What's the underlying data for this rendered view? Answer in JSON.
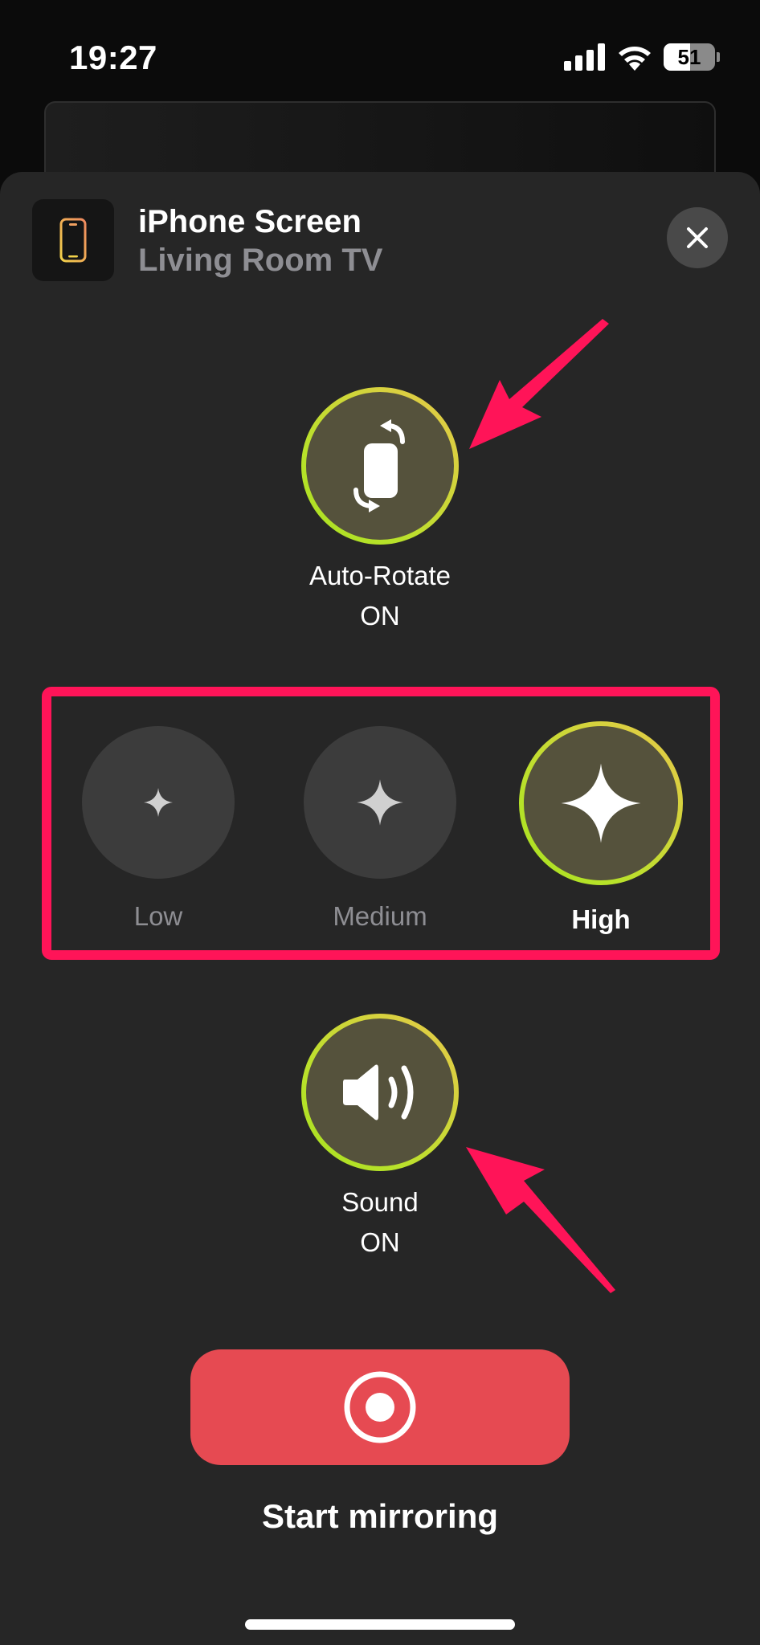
{
  "status_bar": {
    "time": "19:27",
    "battery_percent": 51,
    "battery_label": "51",
    "icons": [
      "cellular-signal-icon",
      "wifi-icon",
      "battery-icon"
    ]
  },
  "header": {
    "title": "iPhone Screen",
    "subtitle": "Living Room TV",
    "app_icon": "iphone-icon",
    "close_icon": "close-icon"
  },
  "auto_rotate": {
    "icon": "rotate-device-icon",
    "label": "Auto-Rotate",
    "state": "ON"
  },
  "quality": {
    "selected": "High",
    "options": [
      {
        "label": "Low",
        "icon": "sparkle-small-icon",
        "selected": false
      },
      {
        "label": "Medium",
        "icon": "sparkle-medium-icon",
        "selected": false
      },
      {
        "label": "High",
        "icon": "sparkle-large-icon",
        "selected": true
      }
    ]
  },
  "sound": {
    "icon": "speaker-wave-icon",
    "label": "Sound",
    "state": "ON"
  },
  "start": {
    "icon": "record-icon",
    "label": "Start mirroring"
  },
  "colors": {
    "annotation": "#ff1458",
    "start_button": "#e64a52",
    "toggle_on_ring_start": "#e8c84a",
    "toggle_on_ring_end": "#a8e020",
    "sheet_background": "#262626"
  }
}
